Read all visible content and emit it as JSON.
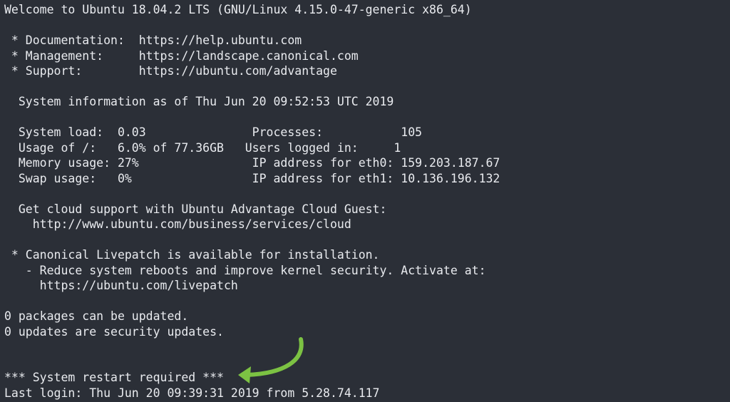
{
  "terminal": {
    "lines": [
      "Welcome to Ubuntu 18.04.2 LTS (GNU/Linux 4.15.0-47-generic x86_64)",
      "",
      " * Documentation:  https://help.ubuntu.com",
      " * Management:     https://landscape.canonical.com",
      " * Support:        https://ubuntu.com/advantage",
      "",
      "  System information as of Thu Jun 20 09:52:53 UTC 2019",
      "",
      "  System load:  0.03               Processes:           105",
      "  Usage of /:   6.0% of 77.36GB   Users logged in:     1",
      "  Memory usage: 27%                IP address for eth0: 159.203.187.67",
      "  Swap usage:   0%                 IP address for eth1: 10.136.196.132",
      "",
      "  Get cloud support with Ubuntu Advantage Cloud Guest:",
      "    http://www.ubuntu.com/business/services/cloud",
      "",
      " * Canonical Livepatch is available for installation.",
      "   - Reduce system reboots and improve kernel security. Activate at:",
      "     https://ubuntu.com/livepatch",
      "",
      "0 packages can be updated.",
      "0 updates are security updates.",
      "",
      "",
      "*** System restart required ***",
      "Last login: Thu Jun 20 09:39:31 2019 from 5.28.74.117"
    ]
  },
  "annotation": {
    "arrow_color": "#7cc243",
    "icon": "curved-arrow-icon"
  },
  "colors": {
    "background": "#2b2f37",
    "text": "#e9ebef"
  }
}
